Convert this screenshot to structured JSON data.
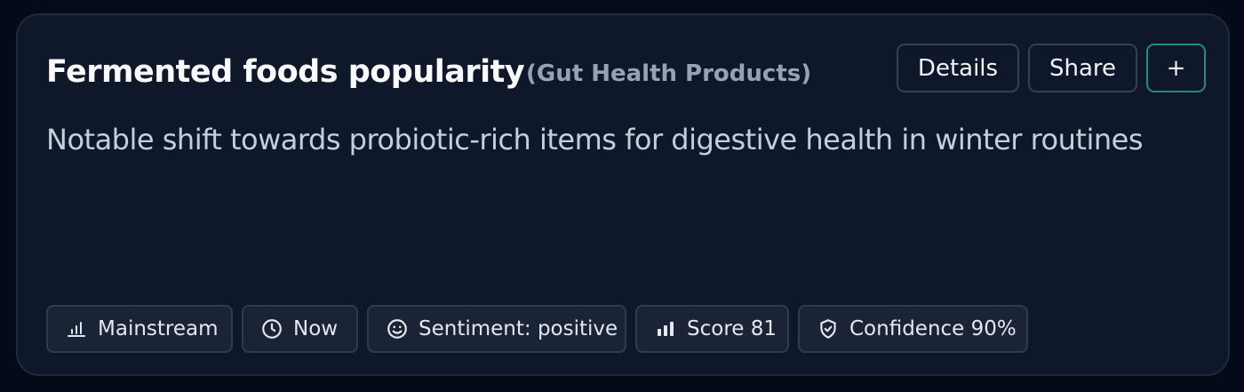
{
  "card": {
    "title": "Fermented foods popularity",
    "category": "(Gut Health Products)",
    "description": "Notable shift towards probiotic-rich items for digestive health in winter routines"
  },
  "actions": {
    "details_label": "Details",
    "share_label": "Share",
    "add_label": "+"
  },
  "chips": [
    {
      "icon": "bar-chart-outline-icon",
      "label": "Mainstream"
    },
    {
      "icon": "clock-icon",
      "label": "Now"
    },
    {
      "icon": "smiley-icon",
      "label": "Sentiment: positive"
    },
    {
      "icon": "bar-chart-filled-icon",
      "label": "Score 81"
    },
    {
      "icon": "shield-check-icon",
      "label": "Confidence 90%"
    }
  ],
  "colors": {
    "background": "#050a18",
    "card": "#0f172a",
    "accent_border": "#1f8f78",
    "muted_text": "#94a3b8"
  }
}
